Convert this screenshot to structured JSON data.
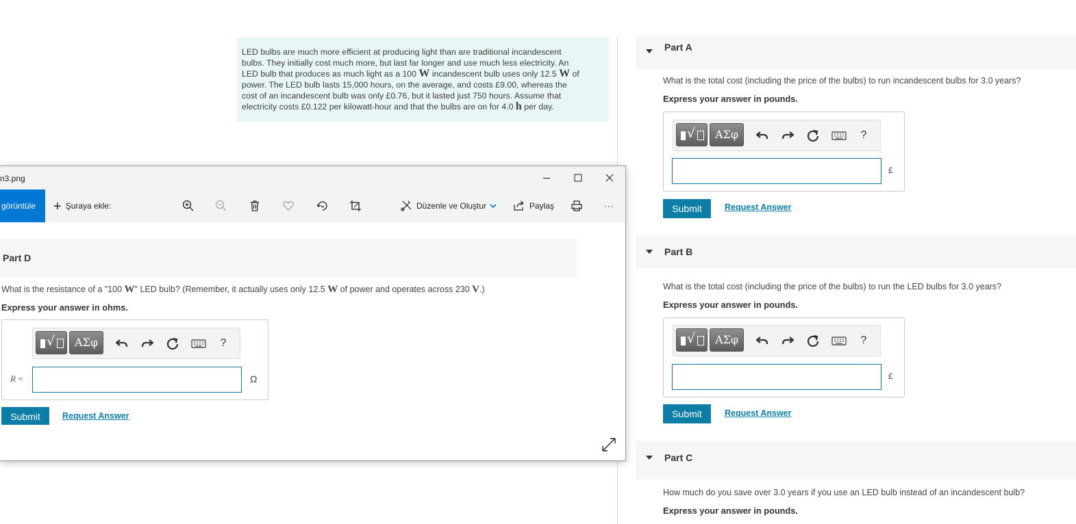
{
  "problem": {
    "lines": [
      [
        {
          "t": "LED bulbs are much more efficient at producing light than are traditional incandescent"
        }
      ],
      [
        {
          "t": "bulbs. They initially cost much more, but last far longer and use much less electricity. An"
        }
      ],
      [
        {
          "t": "LED bulb that produces as much light as a 100 "
        },
        {
          "t": "W",
          "s": 1
        },
        {
          "t": " incandescent bulb uses only 12.5 "
        },
        {
          "t": "W",
          "s": 1
        },
        {
          "t": " of"
        }
      ],
      [
        {
          "t": "power. The LED bulb lasts 15,000 hours, on the average, and costs £9.00, whereas the"
        }
      ],
      [
        {
          "t": "cost of an incandescent bulb was only £0.76, but it lasted just 750 hours. Assume that"
        }
      ],
      [
        {
          "t": "electricity costs £0.122 per kilowatt-hour and that the bulbs are on for 4.0 "
        },
        {
          "t": "h",
          "s": 1
        },
        {
          "t": " per day."
        }
      ]
    ]
  },
  "toolbar": {
    "greek_label": "ΑΣφ",
    "help_label": "?"
  },
  "common": {
    "submit_label": "Submit",
    "request_label": "Request Answer"
  },
  "partA": {
    "title": "Part A",
    "question": "What is the total cost (including the price of the bulbs) to run incandescent bulbs for 3.0 years?",
    "instruction": "Express your answer in pounds.",
    "unit": "£",
    "value": ""
  },
  "partB": {
    "title": "Part B",
    "question": "What is the total cost (including the price of the bulbs) to run the LED bulbs for 3.0 years?",
    "instruction": "Express your answer in pounds.",
    "unit": "£",
    "value": ""
  },
  "partC": {
    "title": "Part C",
    "question": "How much do you save over 3.0 years if you use an LED bulb instead of an incandescent bulb?",
    "instruction": "Express your answer in pounds."
  },
  "viewer": {
    "filename": "n3.png",
    "tab_label": "görüntüle",
    "add_label": "Şuraya ekle:",
    "edit_label": "Düzenle ve Oluştur",
    "share_label": "Paylaş",
    "more_label": "···"
  },
  "partD": {
    "title": "Part D",
    "question_pre": "What is the resistance of a \"100 ",
    "unit_w": "W",
    "question_mid": "\" LED bulb? (Remember, it actually uses only 12.5 ",
    "question_mid2": " of power and operates across 230 ",
    "unit_v": "V",
    "question_post": ".)",
    "instruction": "Express your answer in ohms.",
    "var_name": "R",
    "var_eq": " =",
    "unit": "Ω",
    "value": ""
  }
}
